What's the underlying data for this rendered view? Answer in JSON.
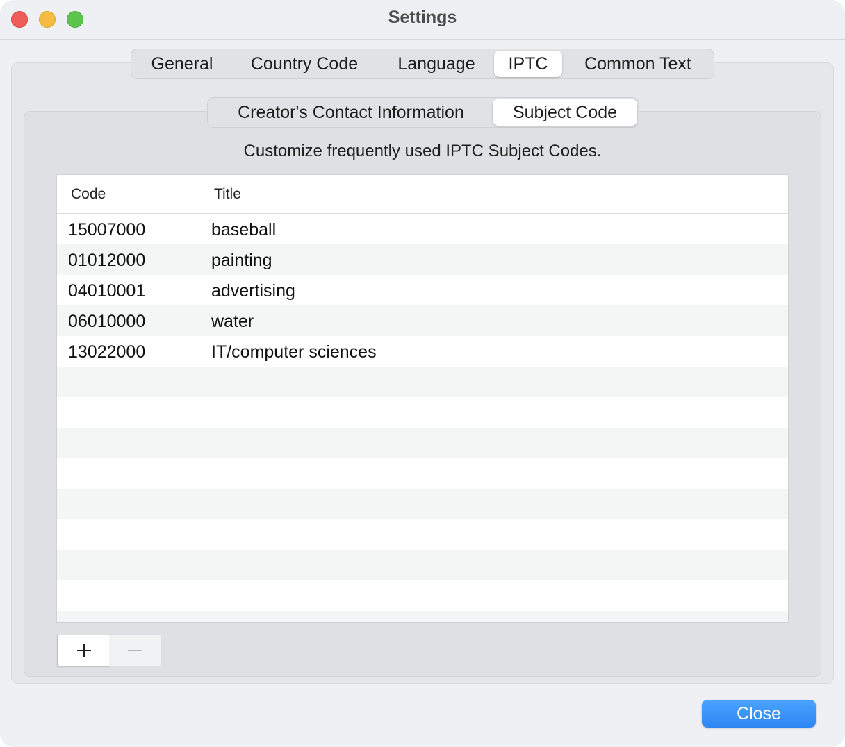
{
  "window": {
    "title": "Settings"
  },
  "top_tabs": [
    {
      "label": "General",
      "active": false
    },
    {
      "label": "Country Code",
      "active": false
    },
    {
      "label": "Language",
      "active": false
    },
    {
      "label": "IPTC",
      "active": true
    },
    {
      "label": "Common Text",
      "active": false
    }
  ],
  "sub_tabs": [
    {
      "label": "Creator's Contact Information",
      "active": false
    },
    {
      "label": "Subject Code",
      "active": true
    }
  ],
  "description": "Customize frequently used IPTC Subject Codes.",
  "table": {
    "columns": [
      "Code",
      "Title"
    ],
    "rows": [
      {
        "code": "15007000",
        "title": "baseball"
      },
      {
        "code": "01012000",
        "title": "painting"
      },
      {
        "code": "04010001",
        "title": "advertising"
      },
      {
        "code": "06010000",
        "title": "water"
      },
      {
        "code": "13022000",
        "title": "IT/computer sciences"
      }
    ]
  },
  "buttons": {
    "add_icon": "plus-icon",
    "remove_icon": "minus-icon",
    "close_label": "Close"
  },
  "colors": {
    "accent": "#2f86f3"
  }
}
